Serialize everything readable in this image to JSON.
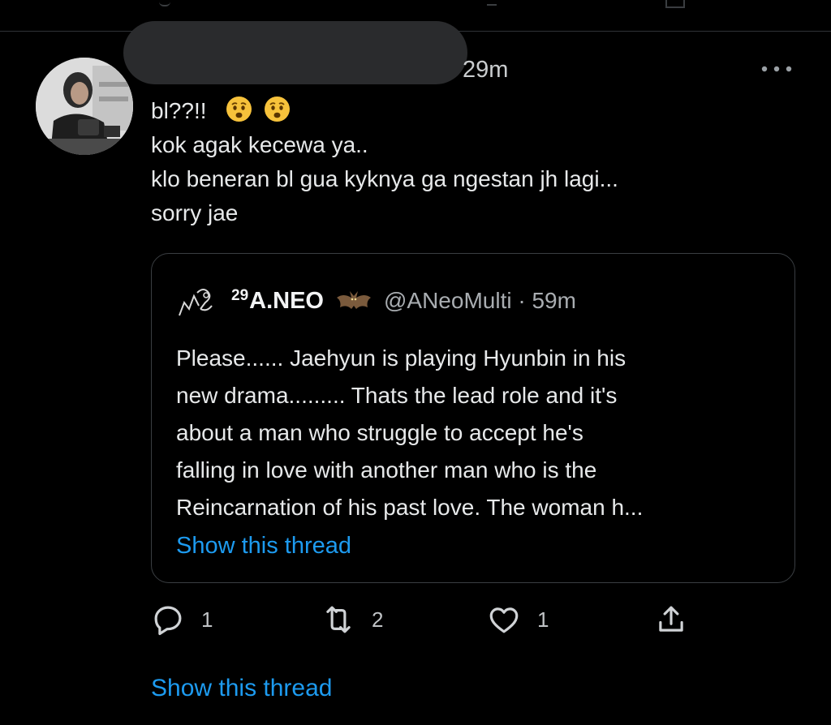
{
  "tweet": {
    "time": "29m",
    "lines": [
      "bl??!!",
      "kok agak kecewa ya..",
      "klo beneran bl gua kyknya ga ngestan jh lagi...",
      "sorry jae"
    ],
    "emoji_icons": [
      "anxious-face-emoji",
      "anxious-face-emoji"
    ]
  },
  "quoted_tweet": {
    "name_prefix": "29",
    "name": "A.NEO",
    "handle_time": "@ANeoMulti · 59m",
    "lines": [
      "Please...... Jaehyun is playing Hyunbin in his",
      "new drama......... Thats the lead role and it's",
      "about a man who struggle to accept he's",
      "falling in love with another man who is the",
      "Reincarnation of his past love. The woman h..."
    ],
    "show_thread": "Show this thread"
  },
  "actions": {
    "reply_count": "1",
    "retweet_count": "2",
    "like_count": "1"
  },
  "show_thread": "Show this thread",
  "colors": {
    "background": "#000000",
    "link": "#1d9bf0",
    "border": "#2f3336"
  }
}
